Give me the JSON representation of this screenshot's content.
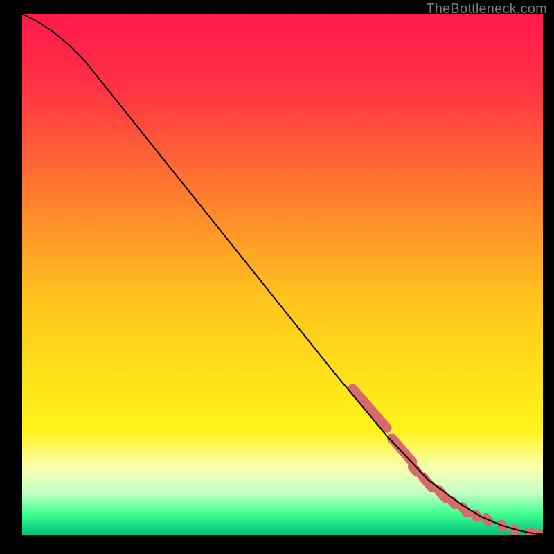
{
  "attribution": "TheBottleneck.com",
  "colors": {
    "curve": "#000000",
    "marker_fill": "#d76a6a",
    "gradient_stops": [
      {
        "offset": 0.0,
        "color": "#ff1a4b"
      },
      {
        "offset": 0.14,
        "color": "#ff3244"
      },
      {
        "offset": 0.34,
        "color": "#ff7a2f"
      },
      {
        "offset": 0.54,
        "color": "#ffc21e"
      },
      {
        "offset": 0.7,
        "color": "#ffe21a"
      },
      {
        "offset": 0.8,
        "color": "#fff31a"
      },
      {
        "offset": 0.87,
        "color": "#faffb0"
      },
      {
        "offset": 0.92,
        "color": "#c4ffc4"
      },
      {
        "offset": 0.96,
        "color": "#3fff90"
      },
      {
        "offset": 1.0,
        "color": "#00c47a"
      }
    ]
  },
  "chart_data": {
    "type": "line",
    "title": "",
    "xlabel": "",
    "ylabel": "",
    "xlim": [
      0,
      100
    ],
    "ylim": [
      0,
      100
    ],
    "series": [
      {
        "name": "curve",
        "x": [
          0,
          3,
          6,
          9,
          12,
          20,
          30,
          40,
          50,
          60,
          70,
          78,
          84,
          88,
          92,
          95,
          97,
          98.5,
          100
        ],
        "y": [
          100,
          98.5,
          96.5,
          94,
          91,
          81,
          68.5,
          56,
          43.5,
          31,
          19,
          10.5,
          6,
          3.5,
          1.8,
          0.9,
          0.45,
          0.2,
          0.1
        ]
      }
    ],
    "markers": [
      {
        "x": 63.5,
        "y0": 28.0,
        "y1": 20.5
      },
      {
        "x": 71.0,
        "y0": 18.5,
        "y1": 14.0
      },
      {
        "x": 75.0,
        "y0": 13.0,
        "y1": 12.0
      },
      {
        "x": 77.0,
        "y0": 11.0,
        "y1": 9.0
      },
      {
        "x": 80.0,
        "y0": 8.5,
        "y1": 7.0
      },
      {
        "x": 82.5,
        "y0": 6.5,
        "y1": 5.8
      },
      {
        "x": 84.5,
        "y0": 5.3,
        "y1": 4.2
      },
      {
        "x": 87.0,
        "y0": 3.8,
        "y1": 3.4
      },
      {
        "x": 89.0,
        "y0": 3.2,
        "y1": 2.5
      },
      {
        "x": 92.0,
        "y0": 1.9,
        "y1": 1.5
      },
      {
        "x": 94.5,
        "y0": 1.0,
        "y1": 0.9
      },
      {
        "x": 97.5,
        "y0": 0.45,
        "y1": 0.4
      },
      {
        "x": 99.3,
        "y0": 0.15,
        "y1": 0.12
      }
    ],
    "marker_radius": 7
  }
}
